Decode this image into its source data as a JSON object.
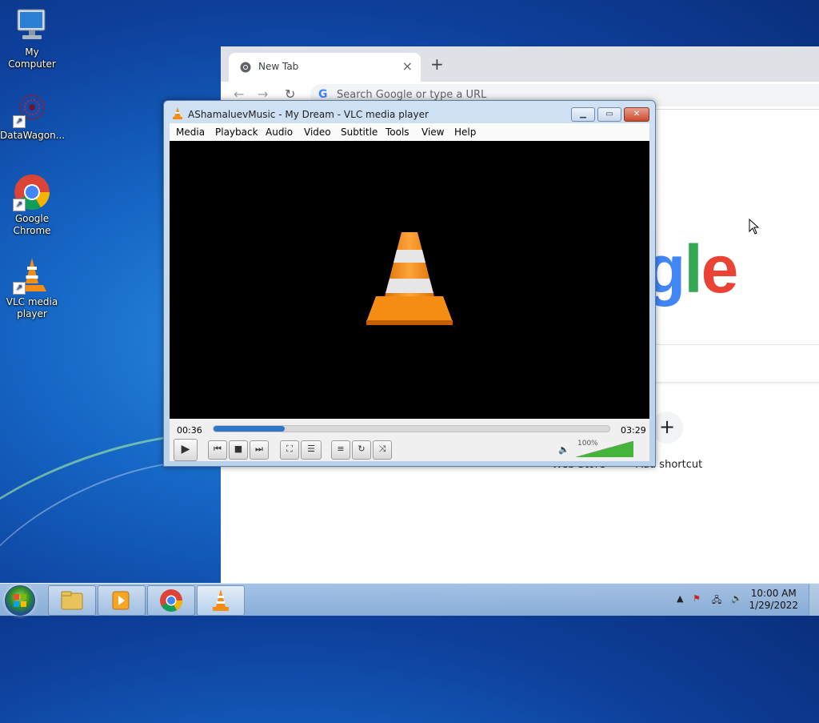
{
  "desktop": {
    "icons": [
      {
        "label": "My Computer",
        "icon": "computer-icon"
      },
      {
        "label": "DataWagon...",
        "icon": "datawagon-icon"
      },
      {
        "label": "Google Chrome",
        "icon": "chrome-icon"
      },
      {
        "label": "VLC media player",
        "icon": "vlc-icon"
      }
    ]
  },
  "chrome": {
    "tab_title": "New Tab",
    "omnibox_placeholder": "Search Google or type a URL",
    "logo_fragment": [
      "g",
      "l",
      "e"
    ],
    "shortcut_partial": "Web Store",
    "add_shortcut": "Add shortcut"
  },
  "vlc": {
    "title": "AShamaluevMusic - My Dream - VLC media player",
    "menu": [
      "Media",
      "Playback",
      "Audio",
      "Video",
      "Subtitle",
      "Tools",
      "View",
      "Help"
    ],
    "elapsed": "00:36",
    "total": "03:29",
    "progress": 0.18,
    "volume_label": "100%",
    "volume": 1.0
  },
  "taskbar": {
    "time": "10:00 AM",
    "date": "1/29/2022"
  },
  "colors": {
    "vlc_orange": "#f58d14",
    "seek_blue": "#2d76c8",
    "google_blue": "#4285f4",
    "google_green": "#34a853",
    "google_red": "#ea4335"
  }
}
